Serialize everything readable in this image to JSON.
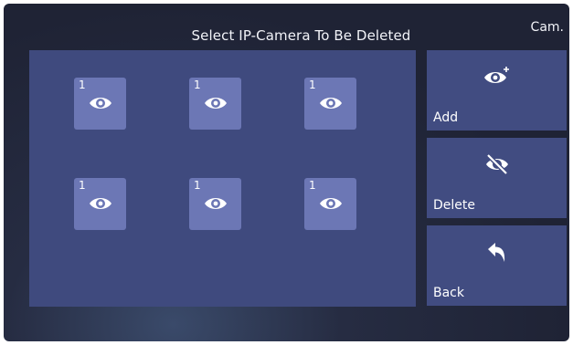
{
  "header": {
    "title": "Select IP-Camera To Be Deleted",
    "mode_label": "Cam."
  },
  "cameras": [
    {
      "number": "1",
      "icon": "eye-icon"
    },
    {
      "number": "1",
      "icon": "eye-icon"
    },
    {
      "number": "1",
      "icon": "eye-icon"
    },
    {
      "number": "1",
      "icon": "eye-icon"
    },
    {
      "number": "1",
      "icon": "eye-icon"
    },
    {
      "number": "1",
      "icon": "eye-icon"
    }
  ],
  "actions": {
    "add": {
      "label": "Add",
      "icon": "eye-plus-icon"
    },
    "delete": {
      "label": "Delete",
      "icon": "eye-off-icon"
    },
    "back": {
      "label": "Back",
      "icon": "back-arrow-icon"
    }
  },
  "colors": {
    "background": "#1f2335",
    "panel": "#3f4a7e",
    "tile": "#6c77b5",
    "button": "#414c81"
  }
}
